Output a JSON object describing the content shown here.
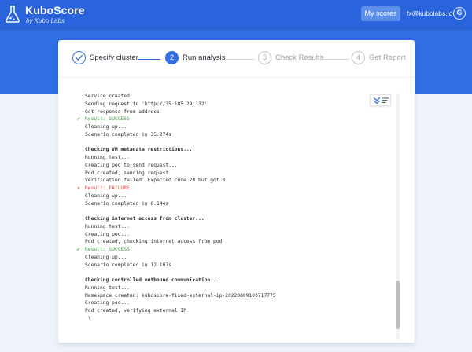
{
  "brand": {
    "title": "KuboScore",
    "subtitle": "by Kubo Labs"
  },
  "header": {
    "my_scores_label": "My scores",
    "user_email": "fx@kubolabs.io",
    "avatar_letter": "G"
  },
  "stepper": {
    "steps": [
      {
        "number": "1",
        "label": "Specify cluster",
        "state": "done"
      },
      {
        "number": "2",
        "label": "Run analysis",
        "state": "active"
      },
      {
        "number": "3",
        "label": "Check Results",
        "state": "todo"
      },
      {
        "number": "4",
        "label": "Get Report",
        "state": "todo"
      }
    ]
  },
  "log": {
    "lines": [
      {
        "text": "Service created",
        "style": "normal"
      },
      {
        "text": "Sending request to 'http://35.185.29.132'",
        "style": "normal"
      },
      {
        "text": "Got response from address",
        "style": "normal"
      },
      {
        "text": "Result: SUCCESS",
        "style": "success"
      },
      {
        "text": "Cleaning up...",
        "style": "normal"
      },
      {
        "text": "Scenario completed in 35.274s",
        "style": "normal"
      },
      {
        "text": "",
        "style": "normal"
      },
      {
        "text": "Checking VM metadata restrictions...",
        "style": "bold"
      },
      {
        "text": "Running test...",
        "style": "normal"
      },
      {
        "text": "Creating pod to send request...",
        "style": "normal"
      },
      {
        "text": "Pod created, sending request",
        "style": "normal"
      },
      {
        "text": "Verification failed. Expected code 28 but got 0",
        "style": "normal"
      },
      {
        "text": "Result: FAILURE",
        "style": "failure"
      },
      {
        "text": "Cleaning up...",
        "style": "normal"
      },
      {
        "text": "Scenario completed in 6.144s",
        "style": "normal"
      },
      {
        "text": "",
        "style": "normal"
      },
      {
        "text": "Checking internet access from cluster...",
        "style": "bold"
      },
      {
        "text": "Running test...",
        "style": "normal"
      },
      {
        "text": "Creating pod...",
        "style": "normal"
      },
      {
        "text": "Pod created, checking internet access from pod",
        "style": "normal"
      },
      {
        "text": "Result: SUCCESS",
        "style": "success"
      },
      {
        "text": "Cleaning up...",
        "style": "normal"
      },
      {
        "text": "Scenario completed in 12.107s",
        "style": "normal"
      },
      {
        "text": "",
        "style": "normal"
      },
      {
        "text": "Checking controlled outbound communication...",
        "style": "bold"
      },
      {
        "text": "Running test...",
        "style": "normal"
      },
      {
        "text": "Namespace created: kuboscore-fixed-external-ip-20220809103717775",
        "style": "normal"
      },
      {
        "text": "Creating pod...",
        "style": "normal"
      },
      {
        "text": "Pod created, verifying external IP",
        "style": "normal"
      },
      {
        "text": "\\",
        "style": "spinner"
      }
    ],
    "success_mark": "✔",
    "failure_mark": "✕"
  },
  "icons": {
    "logo": "flask-icon",
    "step_done": "check-icon",
    "log_scroll_down": "chevrons-down-icon",
    "log_wrap": "wrap-lines-icon"
  },
  "colors": {
    "primary": "#2f6fe3",
    "success": "#3aa040",
    "failure": "#de4a3e"
  }
}
